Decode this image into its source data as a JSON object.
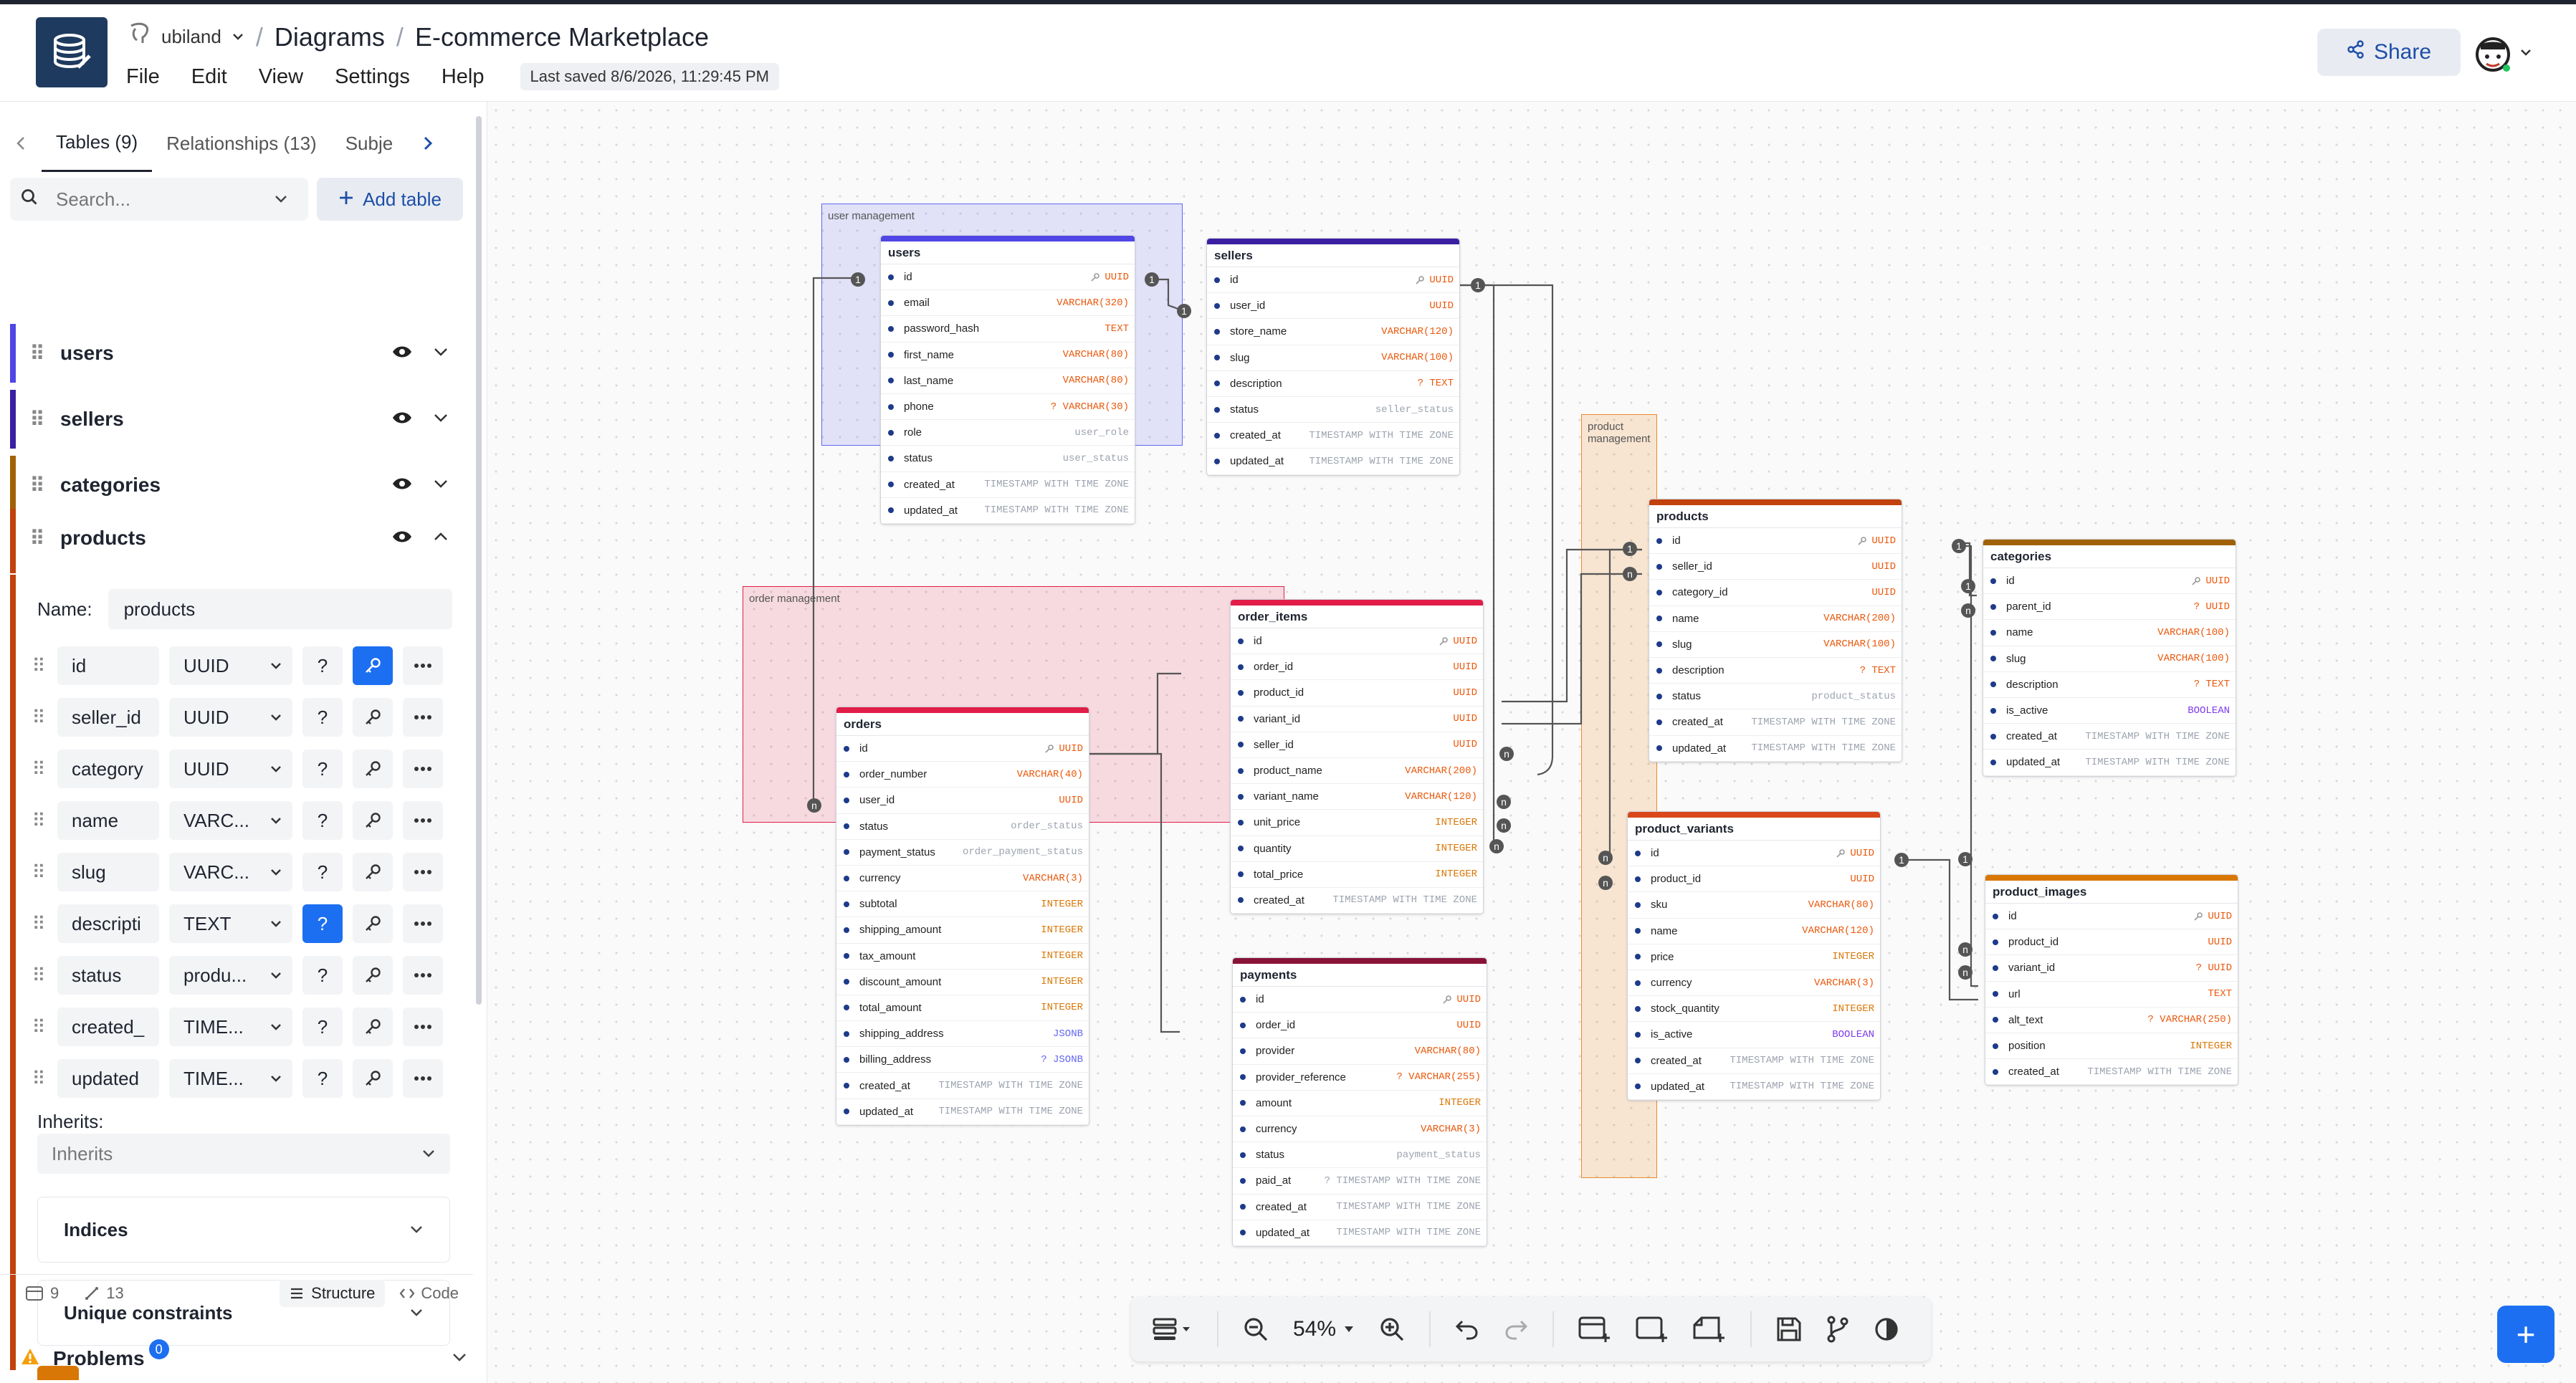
{
  "header": {
    "db_name": "ubiland",
    "crumb_diagrams": "Diagrams",
    "crumb_separator": "/",
    "crumb_title": "E-commerce Marketplace",
    "menu": [
      "File",
      "Edit",
      "View",
      "Settings",
      "Help"
    ],
    "last_saved": "Last saved 8/6/2026, 11:29:45 PM",
    "share_label": "Share"
  },
  "sidebar": {
    "tabs": [
      "Tables (9)",
      "Relationships (13)",
      "Subje"
    ],
    "search_placeholder": "Search...",
    "add_table_label": "Add table",
    "collapsed_tables": [
      {
        "name": "users",
        "color": "#4f46e5"
      },
      {
        "name": "sellers",
        "color": "#3b1fa3"
      },
      {
        "name": "categories",
        "color": "#a16207"
      }
    ],
    "expanded_table": {
      "name": "products",
      "name_label": "Name:",
      "name_value": "products",
      "fields": [
        {
          "name": "id",
          "type": "UUID",
          "nullable": false,
          "pk": true
        },
        {
          "name": "seller_id",
          "type": "UUID",
          "nullable": false,
          "pk": false
        },
        {
          "name": "category",
          "type": "UUID",
          "nullable": false,
          "pk": false
        },
        {
          "name": "name",
          "type": "VARC...",
          "nullable": false,
          "pk": false
        },
        {
          "name": "slug",
          "type": "VARC...",
          "nullable": false,
          "pk": false
        },
        {
          "name": "descripti",
          "type": "TEXT",
          "nullable": true,
          "pk": false
        },
        {
          "name": "status",
          "type": "produ...",
          "nullable": false,
          "pk": false
        },
        {
          "name": "created_",
          "type": "TIME...",
          "nullable": false,
          "pk": false
        },
        {
          "name": "updated",
          "type": "TIME...",
          "nullable": false,
          "pk": false
        }
      ],
      "inherits_label": "Inherits:",
      "inherits_placeholder": "Inherits",
      "indices_label": "Indices",
      "unique_label": "Unique constraints"
    },
    "footer": {
      "tables_count": "9",
      "relations_count": "13",
      "structure_label": "Structure",
      "code_label": "Code"
    },
    "problems_label": "Problems",
    "problems_count": "0"
  },
  "canvas": {
    "areas": [
      {
        "label": "user management",
        "color": "#6366f1",
        "bg": "rgba(99,102,241,0.16)"
      },
      {
        "label": "order management",
        "color": "#e11d48",
        "bg": "rgba(225,29,72,0.14)"
      },
      {
        "label": "product management",
        "color": "#ea8a2c",
        "bg": "rgba(234,138,44,0.20)"
      }
    ],
    "tables": [
      {
        "name": "users",
        "color": "#4f46e5",
        "columns": [
          [
            "id",
            "UUID",
            "pk"
          ],
          [
            "email",
            "VARCHAR(320)",
            ""
          ],
          [
            "password_hash",
            "TEXT",
            ""
          ],
          [
            "first_name",
            "VARCHAR(80)",
            ""
          ],
          [
            "last_name",
            "VARCHAR(80)",
            ""
          ],
          [
            "phone",
            "? VARCHAR(30)",
            ""
          ],
          [
            "role",
            "user_role",
            "enum"
          ],
          [
            "status",
            "user_status",
            "enum"
          ],
          [
            "created_at",
            "TIMESTAMP WITH TIME ZONE",
            "ts"
          ],
          [
            "updated_at",
            "TIMESTAMP WITH TIME ZONE",
            "ts"
          ]
        ]
      },
      {
        "name": "sellers",
        "color": "#3b1fa3",
        "columns": [
          [
            "id",
            "UUID",
            "pk"
          ],
          [
            "user_id",
            "UUID",
            ""
          ],
          [
            "store_name",
            "VARCHAR(120)",
            ""
          ],
          [
            "slug",
            "VARCHAR(100)",
            ""
          ],
          [
            "description",
            "? TEXT",
            ""
          ],
          [
            "status",
            "seller_status",
            "enum"
          ],
          [
            "created_at",
            "TIMESTAMP WITH TIME ZONE",
            "ts"
          ],
          [
            "updated_at",
            "TIMESTAMP WITH TIME ZONE",
            "ts"
          ]
        ]
      },
      {
        "name": "order_items",
        "color": "#e11d48",
        "columns": [
          [
            "id",
            "UUID",
            "pk"
          ],
          [
            "order_id",
            "UUID",
            ""
          ],
          [
            "product_id",
            "UUID",
            ""
          ],
          [
            "variant_id",
            "UUID",
            ""
          ],
          [
            "seller_id",
            "UUID",
            ""
          ],
          [
            "product_name",
            "VARCHAR(200)",
            ""
          ],
          [
            "variant_name",
            "VARCHAR(120)",
            ""
          ],
          [
            "unit_price",
            "INTEGER",
            "int"
          ],
          [
            "quantity",
            "INTEGER",
            "int"
          ],
          [
            "total_price",
            "INTEGER",
            "int"
          ],
          [
            "created_at",
            "TIMESTAMP WITH TIME ZONE",
            "ts"
          ]
        ]
      },
      {
        "name": "orders",
        "color": "#e11d48",
        "columns": [
          [
            "id",
            "UUID",
            "pk"
          ],
          [
            "order_number",
            "VARCHAR(40)",
            ""
          ],
          [
            "user_id",
            "UUID",
            ""
          ],
          [
            "status",
            "order_status",
            "enum"
          ],
          [
            "payment_status",
            "order_payment_status",
            "enum"
          ],
          [
            "currency",
            "VARCHAR(3)",
            ""
          ],
          [
            "subtotal",
            "INTEGER",
            "int"
          ],
          [
            "shipping_amount",
            "INTEGER",
            "int"
          ],
          [
            "tax_amount",
            "INTEGER",
            "int"
          ],
          [
            "discount_amount",
            "INTEGER",
            "int"
          ],
          [
            "total_amount",
            "INTEGER",
            "int"
          ],
          [
            "shipping_address",
            "JSONB",
            "json"
          ],
          [
            "billing_address",
            "? JSONB",
            "json"
          ],
          [
            "created_at",
            "TIMESTAMP WITH TIME ZONE",
            "ts"
          ],
          [
            "updated_at",
            "TIMESTAMP WITH TIME ZONE",
            "ts"
          ]
        ]
      },
      {
        "name": "payments",
        "color": "#881337",
        "columns": [
          [
            "id",
            "UUID",
            "pk"
          ],
          [
            "order_id",
            "UUID",
            ""
          ],
          [
            "provider",
            "VARCHAR(80)",
            ""
          ],
          [
            "provider_reference",
            "? VARCHAR(255)",
            ""
          ],
          [
            "amount",
            "INTEGER",
            "int"
          ],
          [
            "currency",
            "VARCHAR(3)",
            ""
          ],
          [
            "status",
            "payment_status",
            "enum"
          ],
          [
            "paid_at",
            "? TIMESTAMP WITH TIME ZONE",
            "ts"
          ],
          [
            "created_at",
            "TIMESTAMP WITH TIME ZONE",
            "ts"
          ],
          [
            "updated_at",
            "TIMESTAMP WITH TIME ZONE",
            "ts"
          ]
        ]
      },
      {
        "name": "products",
        "color": "#c2410c",
        "columns": [
          [
            "id",
            "UUID",
            "pk"
          ],
          [
            "seller_id",
            "UUID",
            ""
          ],
          [
            "category_id",
            "UUID",
            ""
          ],
          [
            "name",
            "VARCHAR(200)",
            ""
          ],
          [
            "slug",
            "VARCHAR(100)",
            ""
          ],
          [
            "description",
            "? TEXT",
            ""
          ],
          [
            "status",
            "product_status",
            "enum"
          ],
          [
            "created_at",
            "TIMESTAMP WITH TIME ZONE",
            "ts"
          ],
          [
            "updated_at",
            "TIMESTAMP WITH TIME ZONE",
            "ts"
          ]
        ]
      },
      {
        "name": "categories",
        "color": "#a16207",
        "columns": [
          [
            "id",
            "UUID",
            "pk"
          ],
          [
            "parent_id",
            "? UUID",
            ""
          ],
          [
            "name",
            "VARCHAR(100)",
            ""
          ],
          [
            "slug",
            "VARCHAR(100)",
            ""
          ],
          [
            "description",
            "? TEXT",
            ""
          ],
          [
            "is_active",
            "BOOLEAN",
            "bool"
          ],
          [
            "created_at",
            "TIMESTAMP WITH TIME ZONE",
            "ts"
          ],
          [
            "updated_at",
            "TIMESTAMP WITH TIME ZONE",
            "ts"
          ]
        ]
      },
      {
        "name": "product_variants",
        "color": "#d9471b",
        "columns": [
          [
            "id",
            "UUID",
            "pk"
          ],
          [
            "product_id",
            "UUID",
            ""
          ],
          [
            "sku",
            "VARCHAR(80)",
            ""
          ],
          [
            "name",
            "VARCHAR(120)",
            ""
          ],
          [
            "price",
            "INTEGER",
            "int"
          ],
          [
            "currency",
            "VARCHAR(3)",
            ""
          ],
          [
            "stock_quantity",
            "INTEGER",
            "int"
          ],
          [
            "is_active",
            "BOOLEAN",
            "bool"
          ],
          [
            "created_at",
            "TIMESTAMP WITH TIME ZONE",
            "ts"
          ],
          [
            "updated_at",
            "TIMESTAMP WITH TIME ZONE",
            "ts"
          ]
        ]
      },
      {
        "name": "product_images",
        "color": "#d97706",
        "columns": [
          [
            "id",
            "UUID",
            "pk"
          ],
          [
            "product_id",
            "UUID",
            ""
          ],
          [
            "variant_id",
            "? UUID",
            ""
          ],
          [
            "url",
            "TEXT",
            ""
          ],
          [
            "alt_text",
            "? VARCHAR(250)",
            ""
          ],
          [
            "position",
            "INTEGER",
            "int"
          ],
          [
            "created_at",
            "TIMESTAMP WITH TIME ZONE",
            "ts"
          ]
        ]
      }
    ],
    "cardinality_one": "1",
    "cardinality_many": "n"
  },
  "toolbar": {
    "zoom": "54%"
  },
  "colors": {
    "type_default": "#ea580c",
    "type_int": "#d97706",
    "type_enum": "#9ca3af",
    "type_ts": "#9ca3af",
    "type_json": "#6366f1",
    "type_bool": "#7c3aed",
    "accent": "#1d6ff2"
  }
}
